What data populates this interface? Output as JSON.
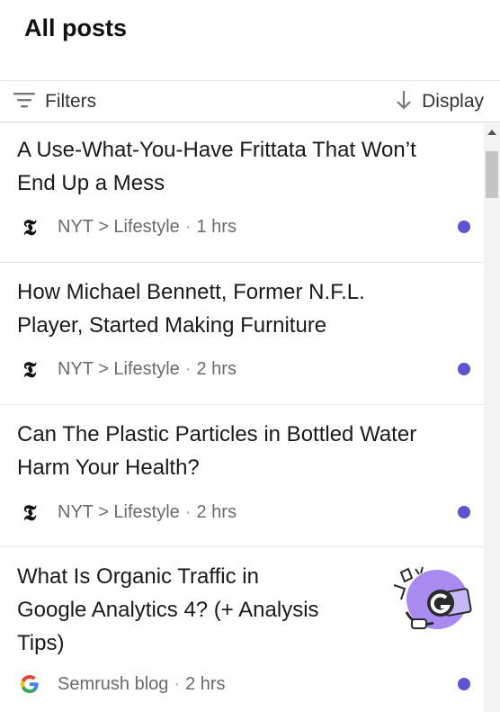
{
  "header": {
    "title": "All posts"
  },
  "toolbar": {
    "filters_label": "Filters",
    "display_label": "Display"
  },
  "colors": {
    "unread": "#5b54d6",
    "thumb_purple": "#a98af0"
  },
  "posts": [
    {
      "title_line1": "A Use-What-You-Have Frittata That Won’t",
      "title_line2": "End Up a Mess",
      "source": "NYT > Lifestyle",
      "time": "1 hrs",
      "source_icon": "nyt-logo-icon",
      "unread": true
    },
    {
      "title_line1": "How Michael Bennett, Former N.F.L.",
      "title_line2": "Player, Started Making Furniture",
      "source": "NYT > Lifestyle",
      "time": "2 hrs",
      "source_icon": "nyt-logo-icon",
      "unread": true
    },
    {
      "title_line1": "Can The Plastic Particles in Bottled Water",
      "title_line2": "Harm Your Health?",
      "source": "NYT > Lifestyle",
      "time": "2 hrs",
      "source_icon": "nyt-logo-icon",
      "unread": true
    },
    {
      "title_line1": "What Is Organic Traffic in",
      "title_line2": "Google Analytics 4? (+ Analysis",
      "title_line3": "Tips)",
      "source": "Semrush blog",
      "time": "2 hrs",
      "source_icon": "google-logo-icon",
      "unread": true
    }
  ]
}
